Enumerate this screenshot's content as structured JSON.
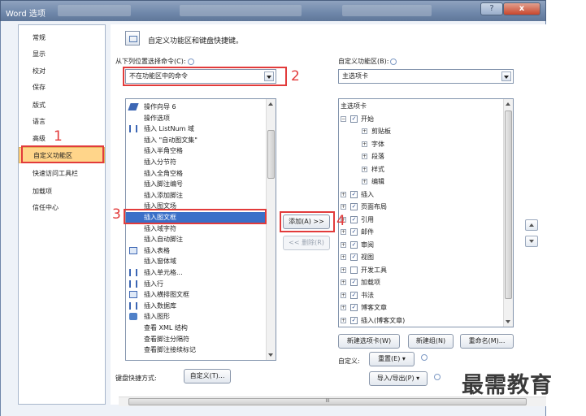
{
  "window": {
    "title": "Word 选项",
    "help_glyph": "?",
    "close_glyph": "x"
  },
  "nav": {
    "items": [
      {
        "label": "常规"
      },
      {
        "label": "显示"
      },
      {
        "label": "校对"
      },
      {
        "label": "保存"
      },
      {
        "label": "版式"
      },
      {
        "label": "语言"
      },
      {
        "label": "高级"
      },
      {
        "label": "自定义功能区",
        "active": true
      },
      {
        "label": "快速访问工具栏"
      },
      {
        "label": "加载项"
      },
      {
        "label": "信任中心"
      }
    ]
  },
  "header": {
    "text": "自定义功能区和键盘快捷键。",
    "icon": "customize-ribbon-icon"
  },
  "left_panel": {
    "label": "从下列位置选择命令(C):",
    "combo_value": "不在功能区中的命令",
    "commands": [
      {
        "label": "操作向导 6",
        "icon": "tag"
      },
      {
        "label": "操作选项",
        "icon": ""
      },
      {
        "label": "插入 ListNum 域",
        "icon": "bars"
      },
      {
        "label": "插入 \"自动图文集\"",
        "icon": ""
      },
      {
        "label": "插入半角空格",
        "icon": ""
      },
      {
        "label": "插入分节符",
        "icon": ""
      },
      {
        "label": "插入全角空格",
        "icon": ""
      },
      {
        "label": "插入脚注编号",
        "icon": ""
      },
      {
        "label": "插入添加脚注",
        "icon": ""
      },
      {
        "label": "插入图文场",
        "icon": ""
      },
      {
        "label": "插入图文框",
        "icon": "",
        "selected": true
      },
      {
        "label": "插入域字符",
        "icon": ""
      },
      {
        "label": "插入自动脚注",
        "icon": ""
      },
      {
        "label": "插入表格",
        "icon": "grid"
      },
      {
        "label": "插入窗体域",
        "icon": ""
      },
      {
        "label": "插入单元格...",
        "icon": "bars"
      },
      {
        "label": "插入行",
        "icon": "bars"
      },
      {
        "label": "插入横排图文框",
        "icon": "grid"
      },
      {
        "label": "插入数据库",
        "icon": "bars"
      },
      {
        "label": "插入图形",
        "icon": "pic"
      },
      {
        "label": "查看 XML 结构",
        "icon": ""
      },
      {
        "label": "查看脚注分隔符",
        "icon": ""
      },
      {
        "label": "查看脚注接续标记",
        "icon": ""
      }
    ],
    "shortcut_label": "键盘快捷方式:",
    "shortcut_button": "自定义(T)..."
  },
  "middle": {
    "add_button": "添加(A) >>",
    "remove_button": "<< 删除(R)"
  },
  "right_panel": {
    "label": "自定义功能区(B):",
    "combo_value": "主选项卡",
    "tree": [
      {
        "label": "主选项卡",
        "level": 0,
        "twisty": "",
        "checkbox": null
      },
      {
        "label": "开始",
        "level": 0,
        "twisty": "−",
        "checkbox": true
      },
      {
        "label": "剪贴板",
        "level": 1,
        "twisty": "+",
        "checkbox": null
      },
      {
        "label": "字体",
        "level": 1,
        "twisty": "+",
        "checkbox": null
      },
      {
        "label": "段落",
        "level": 1,
        "twisty": "+",
        "checkbox": null
      },
      {
        "label": "样式",
        "level": 1,
        "twisty": "+",
        "checkbox": null
      },
      {
        "label": "编辑",
        "level": 1,
        "twisty": "+",
        "checkbox": null
      },
      {
        "label": "插入",
        "level": 0,
        "twisty": "+",
        "checkbox": true
      },
      {
        "label": "页面布局",
        "level": 0,
        "twisty": "+",
        "checkbox": true
      },
      {
        "label": "引用",
        "level": 0,
        "twisty": "+",
        "checkbox": true
      },
      {
        "label": "邮件",
        "level": 0,
        "twisty": "+",
        "checkbox": true
      },
      {
        "label": "审阅",
        "level": 0,
        "twisty": "+",
        "checkbox": true
      },
      {
        "label": "视图",
        "level": 0,
        "twisty": "+",
        "checkbox": true
      },
      {
        "label": "开发工具",
        "level": 0,
        "twisty": "+",
        "checkbox": false
      },
      {
        "label": "加载项",
        "level": 0,
        "twisty": "+",
        "checkbox": true
      },
      {
        "label": "书法",
        "level": 0,
        "twisty": "+",
        "checkbox": true
      },
      {
        "label": "博客文章",
        "level": 0,
        "twisty": "+",
        "checkbox": true
      },
      {
        "label": "插入(博客文章)",
        "level": 0,
        "twisty": "+",
        "checkbox": true
      }
    ],
    "new_tab_button": "新建选项卡(W)",
    "new_group_button": "新建组(N)",
    "rename_button": "重命名(M)...",
    "customize_label": "自定义:",
    "reset_button": "重置(E) ▾",
    "import_export_button": "导入/导出(P) ▾"
  },
  "annotations": {
    "step1": "1",
    "step2": "2",
    "step3": "3",
    "step4": "4",
    "accent": "#e23b3b"
  },
  "watermark": "最需教育",
  "scrollbar_glyph": "III"
}
